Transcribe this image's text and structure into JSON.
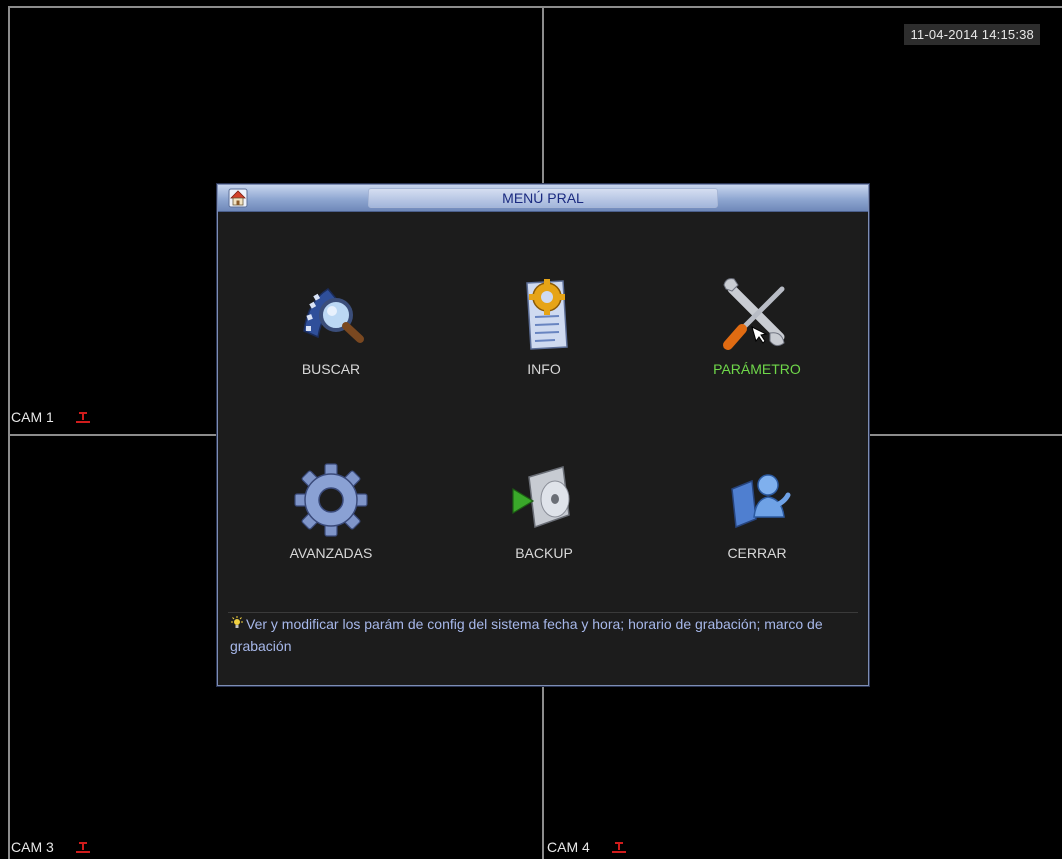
{
  "datetime": "11-04-2014 14:15:38",
  "cameras": [
    {
      "name": "CAM 1"
    },
    {
      "name": "CAM 3"
    },
    {
      "name": "CAM 4"
    }
  ],
  "dialog": {
    "title": "MENÚ PRAL",
    "items": [
      {
        "label": "BUSCAR",
        "icon": "search-film-icon"
      },
      {
        "label": "INFO",
        "icon": "info-document-icon"
      },
      {
        "label": "PARÁMETRO",
        "icon": "tools-icon",
        "selected": true
      },
      {
        "label": "AVANZADAS",
        "icon": "gear-icon"
      },
      {
        "label": "BACKUP",
        "icon": "backup-disc-icon"
      },
      {
        "label": "CERRAR",
        "icon": "logout-user-icon"
      }
    ],
    "hint": "Ver y modificar los parám de config del sistema  fecha y hora; horario de grabación; marco de grabación"
  },
  "colors": {
    "selected_label": "#6fd84a",
    "hint_text": "#a7b8ea",
    "title_text": "#1a2a80",
    "rec_indicator": "#d01c1c"
  }
}
